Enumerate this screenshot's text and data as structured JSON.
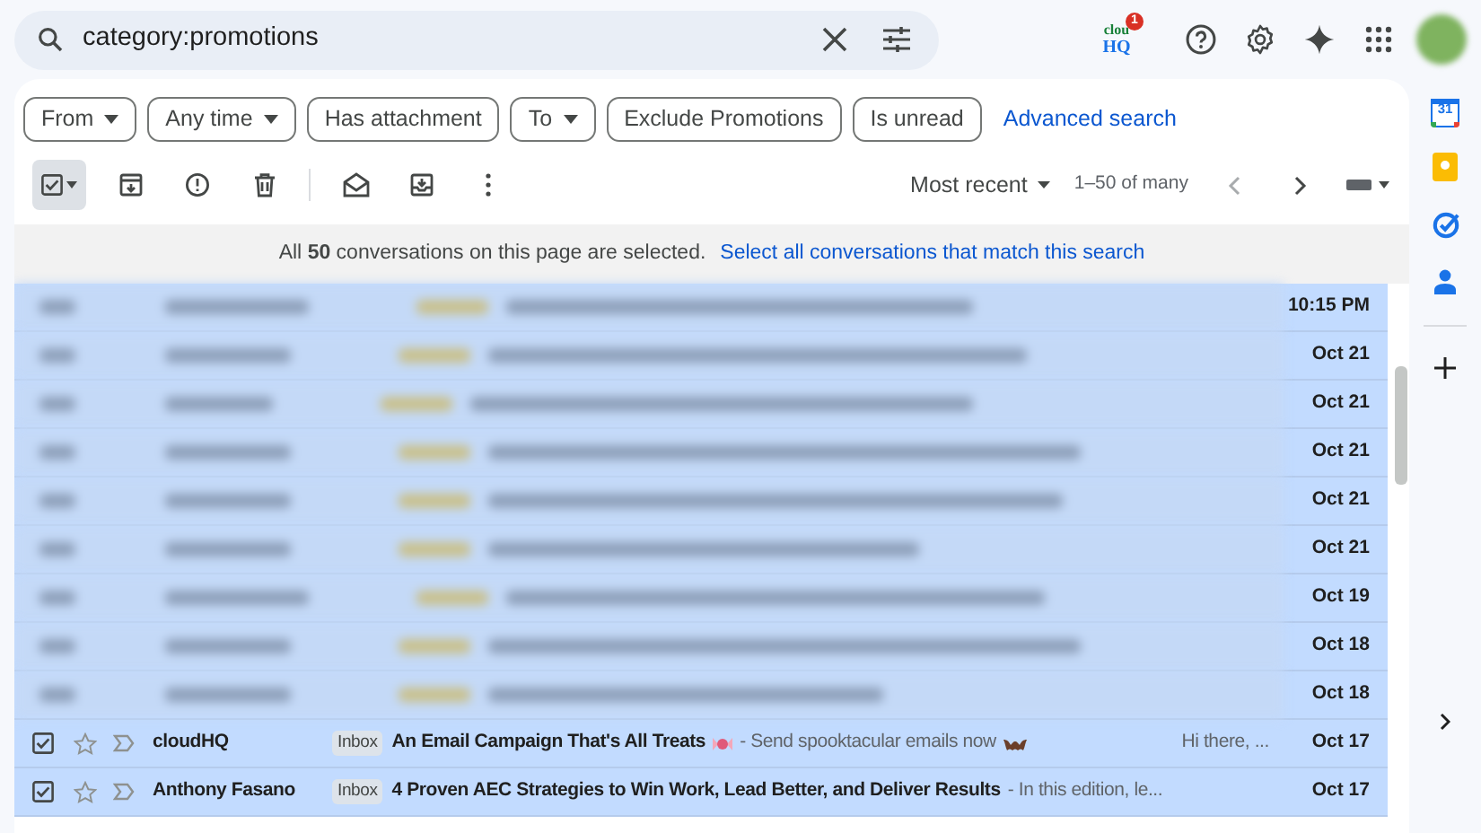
{
  "search": {
    "query": "category:promotions"
  },
  "addon": {
    "top": "clou",
    "bottom": "HQ",
    "badge": "1"
  },
  "filters": [
    {
      "label": "From",
      "dropdown": true
    },
    {
      "label": "Any time",
      "dropdown": true
    },
    {
      "label": "Has attachment",
      "dropdown": false
    },
    {
      "label": "To",
      "dropdown": true
    },
    {
      "label": "Exclude Promotions",
      "dropdown": false
    },
    {
      "label": "Is unread",
      "dropdown": false
    }
  ],
  "advanced_search": "Advanced search",
  "toolbar": {
    "select_all_checked": true,
    "sort": "Most recent",
    "range": "1–50 of many"
  },
  "banner": {
    "text": "All **50** conversations on this page are selected.",
    "link": "Select all conversations that match this search"
  },
  "rows": [
    {
      "kind": "redacted",
      "date": "10:15 PM"
    },
    {
      "kind": "redacted",
      "date": "Oct 21"
    },
    {
      "kind": "redacted",
      "date": "Oct 21"
    },
    {
      "kind": "redacted",
      "date": "Oct 21"
    },
    {
      "kind": "redacted",
      "date": "Oct 21"
    },
    {
      "kind": "redacted",
      "date": "Oct 21"
    },
    {
      "kind": "redacted",
      "date": "Oct 19"
    },
    {
      "kind": "redacted",
      "date": "Oct 18"
    },
    {
      "kind": "redacted",
      "date": "Oct 18"
    },
    {
      "kind": "message",
      "checked": true,
      "starred": false,
      "sender": "cloudHQ",
      "label": "Inbox",
      "subject": "An Email Campaign That's All Treats",
      "snippet": "- Send spooktacular emails now",
      "preview": "Hi there, ...",
      "date": "Oct 17",
      "emoji": true
    },
    {
      "kind": "message",
      "checked": true,
      "starred": false,
      "sender": "Anthony Fasano",
      "label": "Inbox",
      "subject": "4 Proven AEC Strategies to Win Work, Lead Better, and Deliver Results",
      "snippet": "- In this edition, le...",
      "date": "Oct 17",
      "emoji": false
    }
  ],
  "side_panel": {
    "calendar_day": "31"
  }
}
